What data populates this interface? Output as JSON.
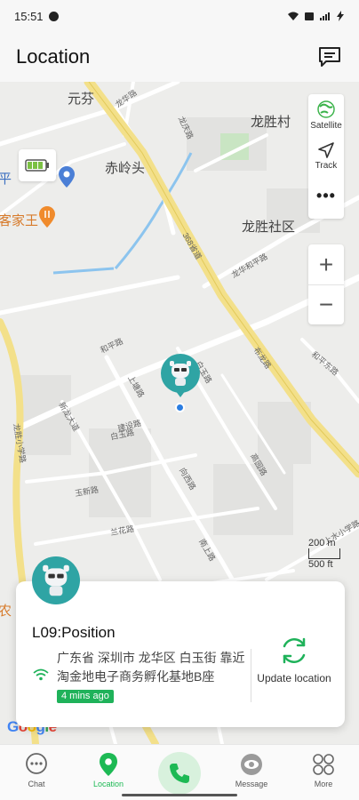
{
  "status_bar": {
    "time": "15:51"
  },
  "header": {
    "title": "Location"
  },
  "map": {
    "place_labels": {
      "yuanfen": "元芬",
      "longsheng_village": "龙胜村",
      "chilingtou": "赤岭头",
      "longsheng_community": "龙胜社区",
      "left_ping": "平",
      "left_jiawang": "客家王",
      "left_nong": "农"
    },
    "road_labels": {
      "longhua": "龙华路",
      "longqing": "龙庆路",
      "g368": "368省道",
      "longhuahe": "龙华和平路",
      "buzhong": "布龙路",
      "heping": "和平路",
      "heping_dong": "和平东路",
      "shangtang": "上塘路",
      "baiyu": "白玉路",
      "jianshe": "建设路",
      "xinlong": "新龙大道",
      "baiyu2": "白玉路",
      "gaoyuan": "高园路",
      "longsheng_xiao": "龙胜小学路",
      "nanshang": "南上路",
      "xiangxi": "向西路",
      "yuxin": "玉新路",
      "lanhua": "兰花路",
      "shangqun": "上水小学路"
    },
    "tools": {
      "satellite": "Satellite",
      "track": "Track",
      "more": "•••"
    },
    "zoom": {
      "in": "+",
      "out": "−"
    },
    "scale": {
      "metric": "200 m",
      "imperial": "500 ft"
    },
    "attribution": "Google"
  },
  "card": {
    "device_name": "L09:Position",
    "address": "广东省 深圳市 龙华区 白玉街 靠近淘金地电子商务孵化基地B座",
    "time_ago": "4 mins ago",
    "update_label": "Update location"
  },
  "nav": {
    "chat": "Chat",
    "location": "Location",
    "message": "Message",
    "more": "More"
  },
  "colors": {
    "accent_green": "#1db954",
    "pin_teal": "#2fa4a4",
    "badge_green": "#1fb25a",
    "highway_yellow": "#f3e08a"
  }
}
